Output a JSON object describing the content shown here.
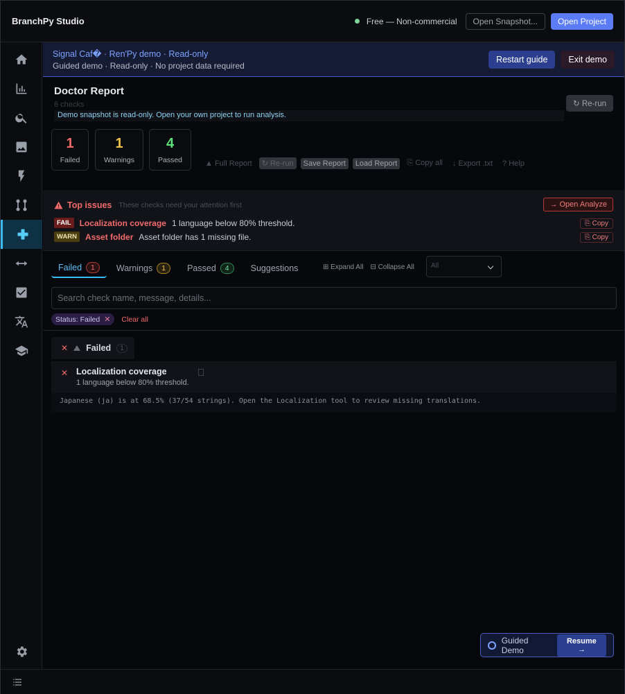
{
  "app": {
    "title": "BranchPy Studio",
    "license": "Free — Non-commercial",
    "open_snapshot": "Open Snapshot...",
    "open_project": "Open Project"
  },
  "sidebar": {
    "items": [
      {
        "icon": "home-icon"
      },
      {
        "icon": "chart-icon"
      },
      {
        "icon": "search-icon"
      },
      {
        "icon": "image-icon"
      },
      {
        "icon": "lightning-icon"
      },
      {
        "icon": "branch-icon"
      },
      {
        "icon": "plus-icon",
        "active": true
      },
      {
        "icon": "arrows-icon"
      },
      {
        "icon": "checkbox-icon"
      },
      {
        "icon": "translate-icon"
      },
      {
        "icon": "graduation-icon"
      }
    ],
    "settings_icon": "gear-icon"
  },
  "banner": {
    "title": "Signal Caf� · Ren'Py demo · Read-only",
    "subtitle": "Guided demo · Read-only · No project data required",
    "restart": "Restart guide",
    "exit": "Exit demo"
  },
  "report": {
    "title": "Doctor Report",
    "count": "6 checks",
    "readonly_note": "Demo snapshot is read-only. Open your own project to run analysis.",
    "rerun": "↻ Re-run"
  },
  "stats": [
    {
      "value": "1",
      "label": "Failed",
      "color": "#f26b6b"
    },
    {
      "value": "1",
      "label": "Warnings",
      "color": "#f0c14b"
    },
    {
      "value": "4",
      "label": "Passed",
      "color": "#5fe07a"
    }
  ],
  "toolbar": {
    "full_report": "▲ Full Report",
    "rerun": "↻ Re-run",
    "save_report": "Save Report",
    "load_report": "Load Report",
    "copy_all": "⎘ Copy all",
    "export": "↓ Export .txt",
    "help": "? Help"
  },
  "top_issues": {
    "title": "Top issues",
    "subtitle": "These checks need your attention first",
    "open_analyze": "→ Open Analyze",
    "copy": "⎘ Copy",
    "items": [
      {
        "tag": "FAIL",
        "name": "Localization coverage",
        "message": "1 language below 80% threshold."
      },
      {
        "tag": "WARN",
        "name": "Asset folder",
        "message": "Asset folder has 1 missing file."
      }
    ]
  },
  "tabs": [
    {
      "label": "Failed",
      "count": "1"
    },
    {
      "label": "Warnings",
      "count": "1"
    },
    {
      "label": "Passed",
      "count": "4"
    },
    {
      "label": "Suggestions"
    }
  ],
  "tab_tools": {
    "expand": "⊞ Expand All",
    "collapse": "⊟ Collapse All"
  },
  "filter": {
    "selected": "All"
  },
  "search": {
    "placeholder": "Search check name, message, details..."
  },
  "chips": {
    "status": "Status: Failed",
    "clear": "Clear all"
  },
  "group": {
    "name": "Failed",
    "count": "1"
  },
  "check": {
    "title": "Localization coverage",
    "message": "1 language below 80% threshold.",
    "detail": "Japanese (ja) is at 68.5% (37/54 strings). Open the Localization tool to review missing translations."
  },
  "guided": {
    "label": "Guided Demo",
    "resume": "Resume →"
  }
}
